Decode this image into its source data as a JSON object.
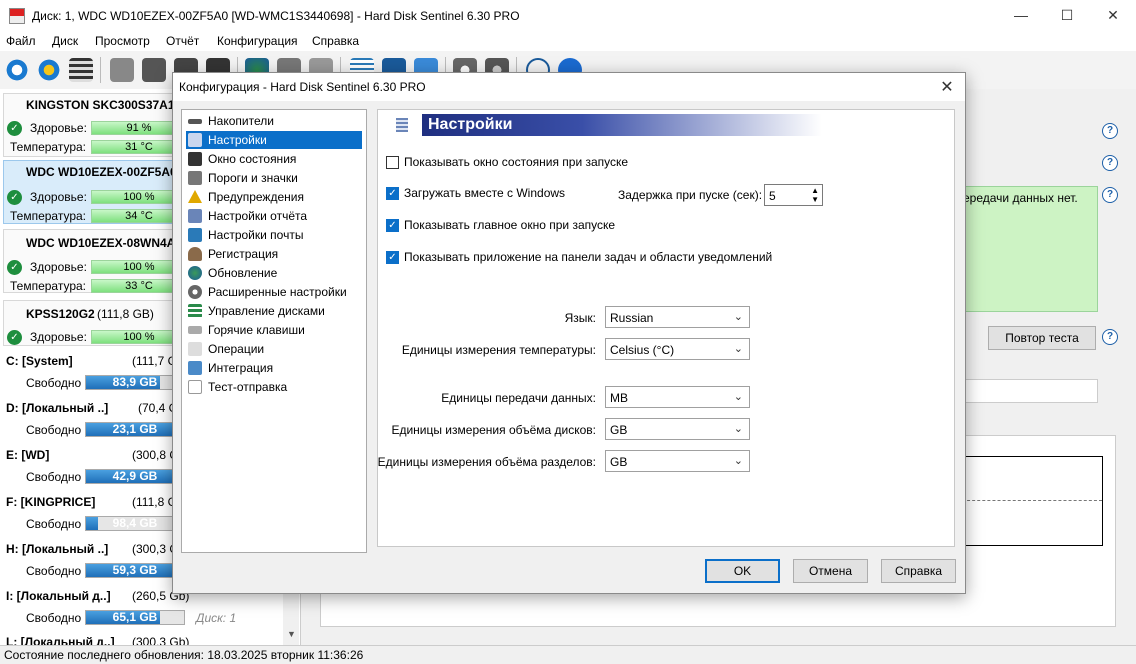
{
  "window": {
    "title": "Диск: 1, WDC WD10EZEX-00ZF5A0 [WD-WMC1S3440698]  -  Hard Disk Sentinel 6.30 PRO",
    "minimize": "—",
    "maximize": "☐",
    "close": "✕"
  },
  "menu": [
    "Файл",
    "Диск",
    "Просмотр",
    "Отчёт",
    "Конфигурация",
    "Справка"
  ],
  "disks": [
    {
      "name": "KINGSTON SKC300S37A12",
      "health_label": "Здоровье:",
      "health": "91 %",
      "health_pct": 91,
      "temp_label": "Температура:",
      "temp": "31 °C"
    },
    {
      "name": "WDC WD10EZEX-00ZF5A0",
      "health_label": "Здоровье:",
      "health": "100 %",
      "health_pct": 100,
      "temp_label": "Температура:",
      "temp": "34 °C"
    },
    {
      "name": "WDC WD10EZEX-08WN4A0",
      "health_label": "Здоровье:",
      "health": "100 %",
      "health_pct": 100,
      "temp_label": "Температура:",
      "temp": "33 °C"
    },
    {
      "name": "KPSS120G2",
      "size": "(111,8 GB)",
      "health_label": "Здоровье:",
      "health": "100 %",
      "health_pct": 100
    }
  ],
  "partitions": [
    {
      "title": "C: [System]",
      "size": "(111,7 G",
      "free_label": "Свободно",
      "free": "83,9 GB",
      "fill_pct": 75
    },
    {
      "title": "D: [Локальный ..]",
      "size": "(70,4 G",
      "free_label": "Свободно",
      "free": "23,1 GB",
      "fill_pct": 100
    },
    {
      "title": "E: [WD]",
      "size": "(300,8 G",
      "free_label": "Свободно",
      "free": "42,9 GB",
      "fill_pct": 100
    },
    {
      "title": "F: [KINGPRICE]",
      "size": "(111,8 G",
      "free_label": "Свободно",
      "free": "98,4 GB",
      "fill_pct": 12
    },
    {
      "title": "H: [Локальный ..]",
      "size": "(300,3 G",
      "free_label": "Свободно",
      "free": "59,3 GB",
      "fill_pct": 100
    },
    {
      "title": "I: [Локальный д..]",
      "size": "(260,5 Gb)",
      "free_label": "Свободно",
      "free": "65,1 GB",
      "fill_pct": 75,
      "disk_ref": "Диск: 1"
    },
    {
      "title": "L: [Локальный д..]",
      "size": "(300,3 Gb)"
    }
  ],
  "right": {
    "transfer_text": "ередачи данных нет.",
    "retest_button": "Повтор теста"
  },
  "status": "Состояние последнего обновления: 18.03.2025 вторник 11:36:26",
  "dialog": {
    "title": "Конфигурация  -  Hard Disk Sentinel 6.30 PRO",
    "close": "✕",
    "nav": [
      {
        "label": "Накопители",
        "icon": "drives-icon",
        "color": "#555"
      },
      {
        "label": "Настройки",
        "icon": "settings-page-icon",
        "color": "#4a6fb0",
        "selected": true
      },
      {
        "label": "Окно состояния",
        "icon": "status-window-icon",
        "color": "#333"
      },
      {
        "label": "Пороги и значки",
        "icon": "thresholds-icon",
        "color": "#777"
      },
      {
        "label": "Предупреждения",
        "icon": "warning-icon",
        "color": "#e0a800"
      },
      {
        "label": "Настройки отчёта",
        "icon": "report-settings-icon",
        "color": "#6a85b8"
      },
      {
        "label": "Настройки почты",
        "icon": "mail-settings-icon",
        "color": "#2a7ab8"
      },
      {
        "label": "Регистрация",
        "icon": "registration-icon",
        "color": "#8a6a4a"
      },
      {
        "label": "Обновление",
        "icon": "update-icon",
        "color": "#2a8a4a"
      },
      {
        "label": "Расширенные настройки",
        "icon": "advanced-settings-icon",
        "color": "#666"
      },
      {
        "label": "Управление дисками",
        "icon": "disk-management-icon",
        "color": "#2a8a4a"
      },
      {
        "label": "Горячие клавиши",
        "icon": "hotkeys-icon",
        "color": "#888"
      },
      {
        "label": "Операции",
        "icon": "operations-icon",
        "color": "#ccc"
      },
      {
        "label": "Интеграция",
        "icon": "integration-icon",
        "color": "#4a8ac8"
      },
      {
        "label": "Тест-отправка",
        "icon": "test-send-icon",
        "color": "#999"
      }
    ],
    "header": "Настройки",
    "options": {
      "show_status_window": {
        "label": "Показывать окно состояния при запуске",
        "checked": false
      },
      "load_with_windows": {
        "label": "Загружать вместе с Windows",
        "checked": true
      },
      "show_main_window": {
        "label": "Показывать главное окно при запуске",
        "checked": true
      },
      "show_in_taskbar": {
        "label": "Показывать приложение на панели задач и области уведомлений",
        "checked": true
      }
    },
    "startup_delay": {
      "label": "Задержка при пуске (сек):",
      "value": "5"
    },
    "language": {
      "label": "Язык:",
      "value": "Russian"
    },
    "temp_units": {
      "label": "Единицы измерения температуры:",
      "value": "Celsius (°C)"
    },
    "transfer_units": {
      "label": "Единицы передачи данных:",
      "value": "MB"
    },
    "disk_units": {
      "label": "Единицы измерения объёма дисков:",
      "value": "GB"
    },
    "partition_units": {
      "label": "Единицы измерения объёма разделов:",
      "value": "GB"
    },
    "buttons": {
      "ok": "OK",
      "cancel": "Отмена",
      "help": "Справка"
    }
  }
}
